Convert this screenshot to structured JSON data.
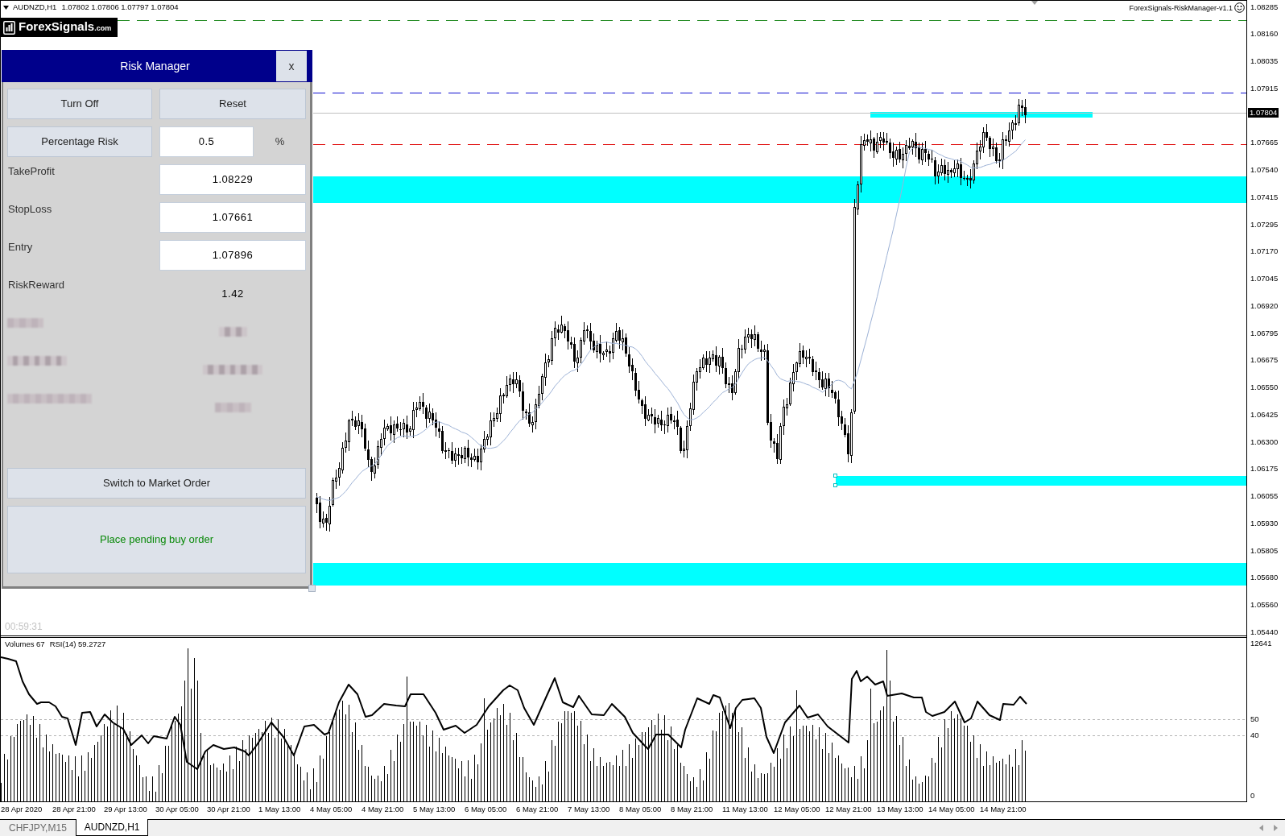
{
  "chart": {
    "symbol": "AUDNZD,H1",
    "quotes": "1.07802 1.07806 1.07797 1.07804",
    "expert": "ForexSignals-RiskManager-v1.1",
    "timer": "00:59:31"
  },
  "logo": {
    "name": "ForexSignals",
    "suffix": ".com"
  },
  "risk_manager": {
    "title": "Risk Manager",
    "close": "x",
    "rows": [
      {
        "kind": "buttons",
        "labels": [
          "Turn Off",
          "Reset"
        ]
      },
      {
        "kind": "percent",
        "button": "Percentage Risk",
        "value": "0.5",
        "unit": "%"
      },
      {
        "kind": "field",
        "label": "TakeProfit",
        "value": "1.08229"
      },
      {
        "kind": "field",
        "label": "StopLoss",
        "value": "1.07661"
      },
      {
        "kind": "field",
        "label": "Entry",
        "value": "1.07896"
      },
      {
        "kind": "readout",
        "label": "RiskReward",
        "value": "1.42"
      },
      {
        "kind": "redacted"
      },
      {
        "kind": "redacted"
      },
      {
        "kind": "redacted"
      }
    ],
    "actions": [
      {
        "kind": "switch",
        "label": "Switch to Market Order"
      },
      {
        "kind": "order",
        "label": "Place pending buy order"
      }
    ]
  },
  "price_axis": [
    {
      "kind": "tick",
      "label": "1.08285"
    },
    {
      "kind": "tick",
      "label": "1.08160"
    },
    {
      "kind": "tick",
      "label": "1.08035"
    },
    {
      "kind": "tick",
      "label": "1.07915"
    },
    {
      "kind": "current",
      "label": "1.07804"
    },
    {
      "kind": "tick",
      "label": "1.07665"
    },
    {
      "kind": "tick",
      "label": "1.07540"
    },
    {
      "kind": "tick",
      "label": "1.07415"
    },
    {
      "kind": "tick",
      "label": "1.07295"
    },
    {
      "kind": "tick",
      "label": "1.07170"
    },
    {
      "kind": "tick",
      "label": "1.07045"
    },
    {
      "kind": "tick",
      "label": "1.06920"
    },
    {
      "kind": "tick",
      "label": "1.06795"
    },
    {
      "kind": "tick",
      "label": "1.06675"
    },
    {
      "kind": "tick",
      "label": "1.06550"
    },
    {
      "kind": "tick",
      "label": "1.06425"
    },
    {
      "kind": "tick",
      "label": "1.06300"
    },
    {
      "kind": "tick",
      "label": "1.06175"
    },
    {
      "kind": "tick",
      "label": "1.06055"
    },
    {
      "kind": "tick",
      "label": "1.05930"
    },
    {
      "kind": "tick",
      "label": "1.05805"
    },
    {
      "kind": "tick",
      "label": "1.05680"
    },
    {
      "kind": "tick",
      "label": "1.05560"
    },
    {
      "kind": "tick",
      "label": "1.05440"
    }
  ],
  "indicator": {
    "legend": [
      "Volumes 67",
      "RSI(14) 59.2727"
    ],
    "axis_labels": [
      "12641",
      "50",
      "40",
      "0"
    ]
  },
  "time_axis": [
    "28 Apr 2020",
    "28 Apr 21:00",
    "29 Apr 13:00",
    "30 Apr 05:00",
    "30 Apr 21:00",
    "1 May 13:00",
    "4 May 05:00",
    "4 May 21:00",
    "5 May 13:00",
    "6 May 05:00",
    "6 May 21:00",
    "7 May 13:00",
    "8 May 05:00",
    "8 May 21:00",
    "11 May 13:00",
    "12 May 05:00",
    "12 May 21:00",
    "13 May 13:00",
    "14 May 05:00",
    "14 May 21:00"
  ],
  "tabs": [
    {
      "label": "CHFJPY,M15",
      "selected": false
    },
    {
      "label": "AUDNZD,H1",
      "selected": true
    }
  ]
}
